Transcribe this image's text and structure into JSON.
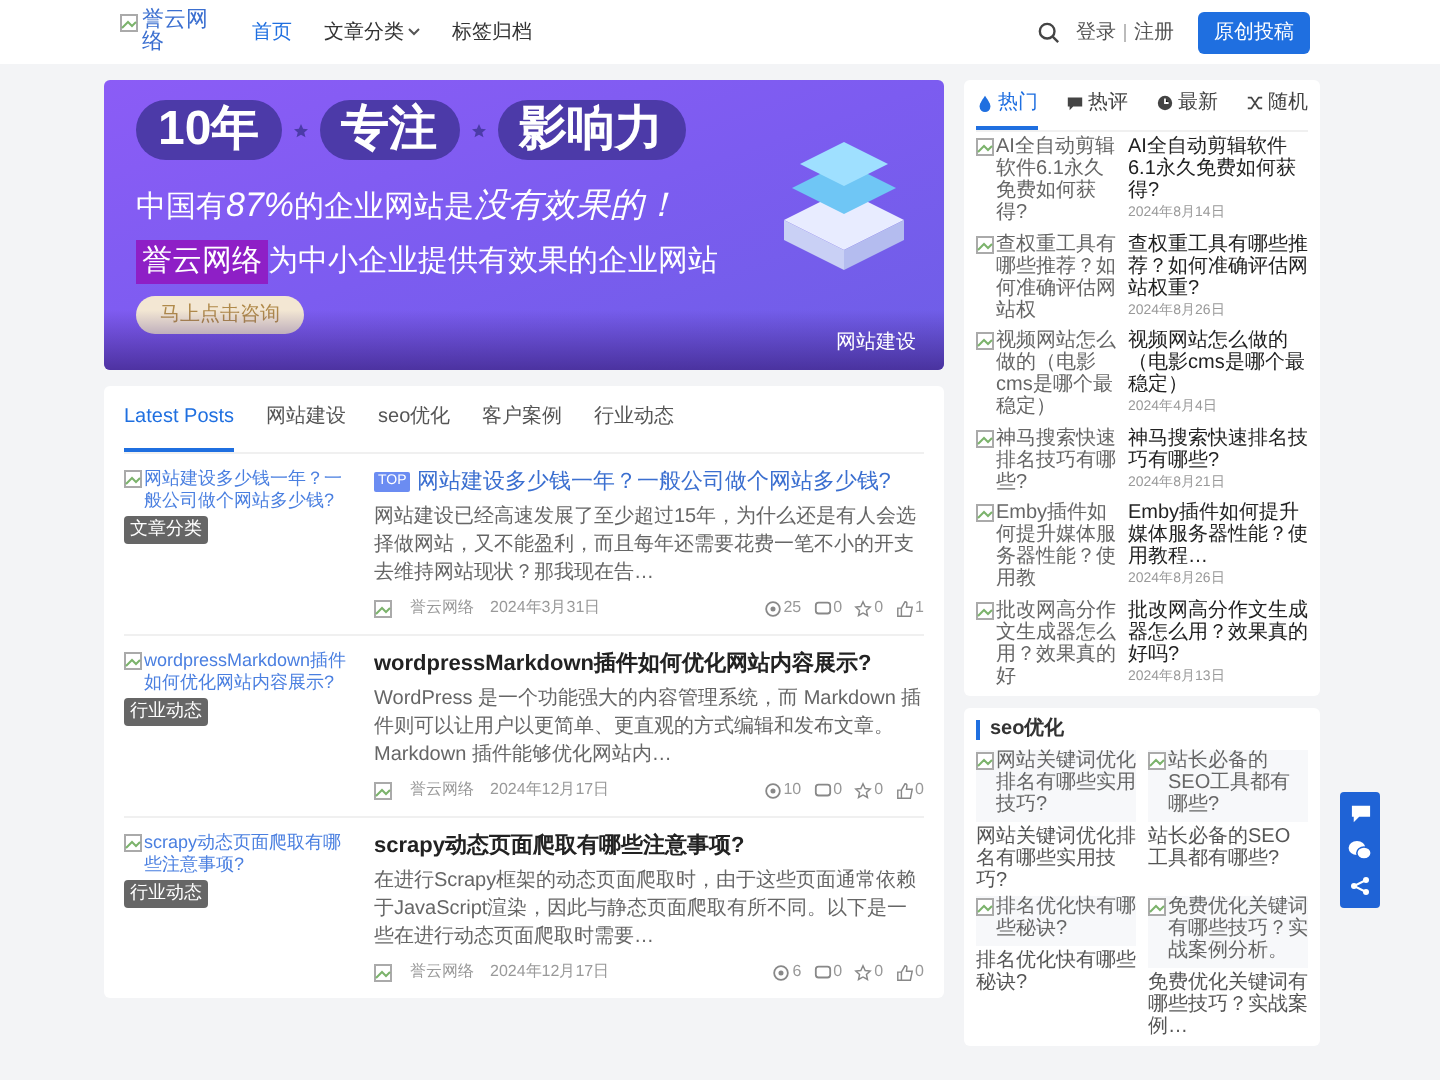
{
  "header": {
    "logo_alt": "誉云网络",
    "nav": [
      {
        "label": "首页",
        "selected": true,
        "dropdown": false
      },
      {
        "label": "文章分类",
        "selected": false,
        "dropdown": true
      },
      {
        "label": "标签归档",
        "selected": false,
        "dropdown": false
      }
    ],
    "login": "登录",
    "register": "注册",
    "submit_button": "原创投稿"
  },
  "banner": {
    "pills": [
      "10年",
      "专注",
      "影响力"
    ],
    "line1": [
      {
        "text": "中国有",
        "emphasis": false
      },
      {
        "text": "87%",
        "emphasis": true
      },
      {
        "text": "的企业网站是",
        "emphasis": false
      },
      {
        "text": "没有效果的！",
        "emphasis": true
      }
    ],
    "brand": "誉云网络",
    "line2": "为中小企业提供有效果的企业网站",
    "cta": "马上点击咨询",
    "caption": "网站建设"
  },
  "tabs": [
    {
      "label": "Latest Posts",
      "selected": true
    },
    {
      "label": "网站建设",
      "selected": false
    },
    {
      "label": "seo优化",
      "selected": false
    },
    {
      "label": "客户案例",
      "selected": false
    },
    {
      "label": "行业动态",
      "selected": false
    }
  ],
  "posts": [
    {
      "image_alt": "网站建设多少钱一年？一般公司做个网站多少钱?",
      "category": "文章分类",
      "badge": "TOP",
      "title": "网站建设多少钱一年？一般公司做个网站多少钱?",
      "excerpt": "网站建设已经高速发展了至少超过15年，为什么还是有人会选择做网站，又不能盈利，而且每年还需要花费一笔不小的开支去维持网站现状？那我现在告…",
      "author": "誉云网络",
      "date": "2024年3月31日",
      "views": "25",
      "comments": "0",
      "favorites": "0",
      "likes": "1"
    },
    {
      "image_alt": "wordpressMarkdown插件如何优化网站内容展示?",
      "category": "行业动态",
      "title": "wordpressMarkdown插件如何优化网站内容展示?",
      "excerpt": "WordPress 是一个功能强大的内容管理系统，而 Markdown 插件则可以让用户以更简单、更直观的方式编辑和发布文章。Markdown 插件能够优化网站内…",
      "author": "誉云网络",
      "date": "2024年12月17日",
      "views": "10",
      "comments": "0",
      "favorites": "0",
      "likes": "0"
    },
    {
      "image_alt": "scrapy动态页面爬取有哪些注意事项?",
      "category": "行业动态",
      "title": "scrapy动态页面爬取有哪些注意事项?",
      "excerpt": "在进行Scrapy框架的动态页面爬取时，由于这些页面通常依赖于JavaScript渲染，因此与静态页面爬取有所不同。以下是一些在进行动态页面爬取时需要…",
      "author": "誉云网络",
      "date": "2024年12月17日",
      "views": "6",
      "comments": "0",
      "favorites": "0",
      "likes": "0"
    }
  ],
  "side_tabs": [
    {
      "label": "热门",
      "kind": "hot",
      "selected": true
    },
    {
      "label": "热评",
      "kind": "comments",
      "selected": false
    },
    {
      "label": "最新",
      "kind": "latest",
      "selected": false
    },
    {
      "label": "随机",
      "kind": "random",
      "selected": false
    }
  ],
  "side_posts": [
    {
      "image_alt": "AI全自动剪辑软件6.1永久免费如何获得?",
      "title": "AI全自动剪辑软件6.1永久免费如何获得?",
      "date": "2024年8月14日"
    },
    {
      "image_alt": "查权重工具有哪些推荐？如何准确评估网站权",
      "title": "查权重工具有哪些推荐？如何准确评估网站权重?",
      "date": "2024年8月26日"
    },
    {
      "image_alt": "视频网站怎么做的（电影cms是哪个最稳定）",
      "title": "视频网站怎么做的（电影cms是哪个最稳定）",
      "date": "2024年4月4日"
    },
    {
      "image_alt": "神马搜索快速排名技巧有哪些?",
      "title": "神马搜索快速排名技巧有哪些?",
      "date": "2024年8月21日"
    },
    {
      "image_alt": "Emby插件如何提升媒体服务器性能？使用教",
      "title": "Emby插件如何提升媒体服务器性能？使用教程…",
      "date": "2024年8月26日"
    },
    {
      "image_alt": "批改网高分作文生成器怎么用？效果真的好",
      "title": "批改网高分作文生成器怎么用？效果真的好吗?",
      "date": "2024年8月13日"
    }
  ],
  "seo": {
    "title": "seo优化",
    "items": [
      {
        "image_alt": "网站关键词优化排名有哪些实用技巧?",
        "title": "网站关键词优化排名有哪些实用技巧?"
      },
      {
        "image_alt": "站长必备的SEO工具都有哪些?",
        "title": "站长必备的SEO工具都有哪些?"
      },
      {
        "image_alt": "排名优化快有哪些秘诀?",
        "title": "排名优化快有哪些秘诀?"
      },
      {
        "image_alt": "免费优化关键词有哪些技巧？实战案例分析。",
        "title": "免费优化关键词有哪些技巧？实战案例…"
      }
    ]
  }
}
